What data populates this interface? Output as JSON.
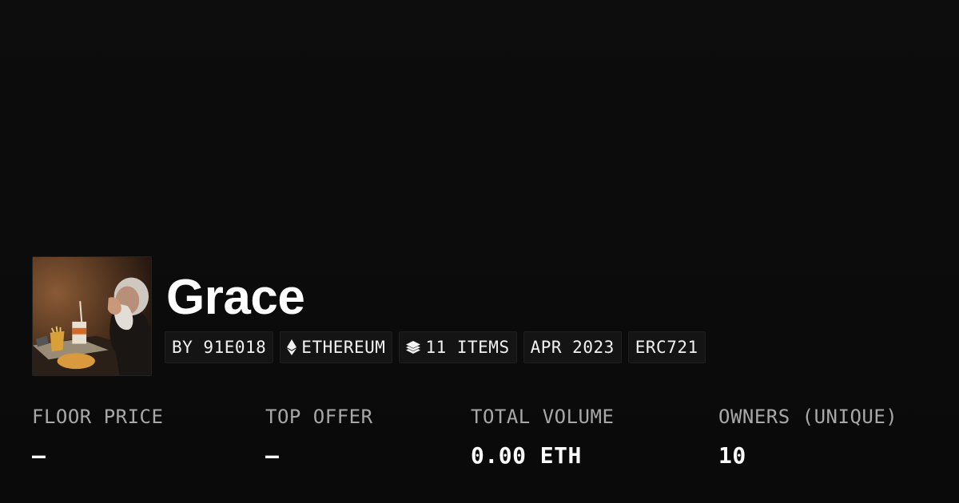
{
  "collection": {
    "title": "Grace",
    "thumbnail_alt": "Painting of an old man praying over fast food",
    "tags": [
      {
        "label": "BY 91E018",
        "icon": ""
      },
      {
        "label": "ETHEREUM",
        "icon": "ethereum-icon"
      },
      {
        "label": "11 ITEMS",
        "icon": "layers-icon"
      },
      {
        "label": "APR 2023",
        "icon": ""
      },
      {
        "label": "ERC721",
        "icon": ""
      }
    ]
  },
  "stats": {
    "floor_price": {
      "label": "FLOOR PRICE",
      "value": "–"
    },
    "top_offer": {
      "label": "TOP OFFER",
      "value": "–"
    },
    "total_volume": {
      "label": "TOTAL VOLUME",
      "value": "0.00 ETH"
    },
    "owners": {
      "label": "OWNERS (UNIQUE)",
      "value": "10"
    }
  },
  "colors": {
    "background": "#0b0b0b",
    "tag_background": "#141414",
    "label_gray": "#a8a8a8",
    "text_white": "#ffffff"
  }
}
